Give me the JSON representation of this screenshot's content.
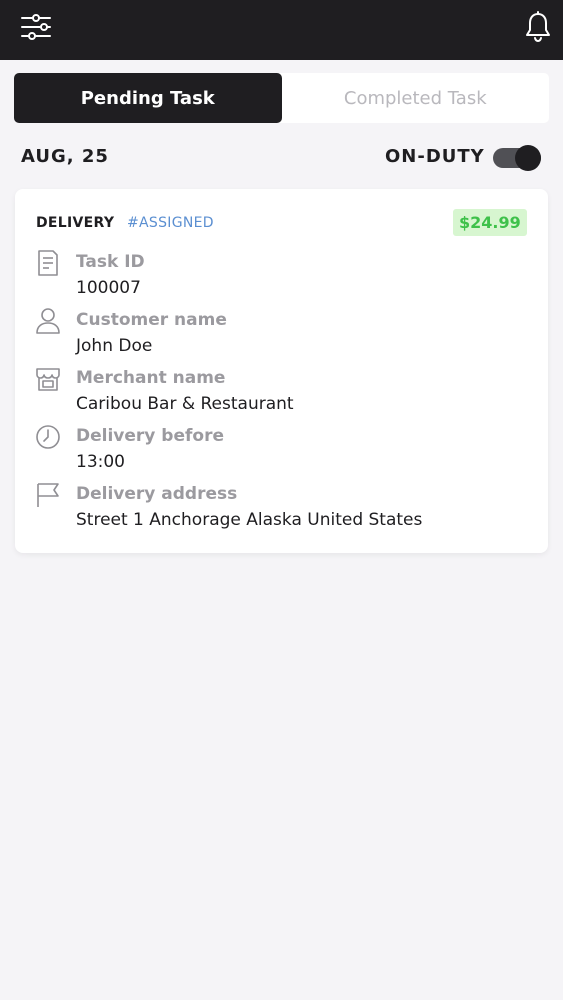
{
  "header": {
    "filter_icon": "sliders-icon",
    "bell_icon": "bell-icon"
  },
  "tabs": [
    {
      "label": "Pending Task",
      "active": true
    },
    {
      "label": "Completed Task",
      "active": false
    }
  ],
  "date": "AUG, 25",
  "duty": {
    "label": "ON-DUTY",
    "on": true
  },
  "task": {
    "type": "DELIVERY",
    "status": "#ASSIGNED",
    "price": "$24.99",
    "fields": [
      {
        "icon": "document-icon",
        "label": "Task ID",
        "value": "100007"
      },
      {
        "icon": "user-icon",
        "label": "Customer name",
        "value": "John Doe"
      },
      {
        "icon": "store-icon",
        "label": "Merchant name",
        "value": "Caribou Bar & Restaurant"
      },
      {
        "icon": "clock-icon",
        "label": "Delivery before",
        "value": "13:00"
      },
      {
        "icon": "flag-icon",
        "label": "Delivery address",
        "value": "Street 1 Anchorage Alaska United States"
      }
    ]
  },
  "colors": {
    "dark": "#1f1e21",
    "price_bg": "#d7f6d0",
    "price_text": "#3ec14a",
    "status_blue": "#5b8fd1",
    "muted_label": "#9b9a9f"
  }
}
